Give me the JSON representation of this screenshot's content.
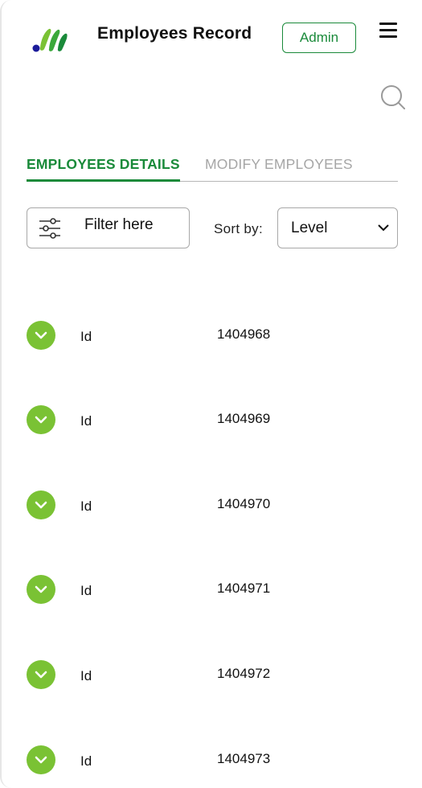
{
  "header": {
    "title": "Employees Record",
    "role_button": "Admin"
  },
  "tabs": [
    {
      "label": "EMPLOYEES DETAILS",
      "active": true
    },
    {
      "label": "MODIFY EMPLOYEES",
      "active": false
    }
  ],
  "toolbar": {
    "filter_label": "Filter here",
    "sort_label": "Sort by:",
    "sort_value": "Level"
  },
  "colors": {
    "accent": "#1a8a3a",
    "expand_button": "#7ac234",
    "inactive_tab": "#a6a6a6"
  },
  "icons": {
    "logo": "brand-logo",
    "menu": "hamburger-icon",
    "search": "search-icon",
    "filter": "sliders-icon",
    "expand": "chevron-down-icon"
  },
  "employees": [
    {
      "field": "Id",
      "value": "1404968"
    },
    {
      "field": "Id",
      "value": "1404969"
    },
    {
      "field": "Id",
      "value": "1404970"
    },
    {
      "field": "Id",
      "value": "1404971"
    },
    {
      "field": "Id",
      "value": "1404972"
    },
    {
      "field": "Id",
      "value": "1404973"
    }
  ]
}
